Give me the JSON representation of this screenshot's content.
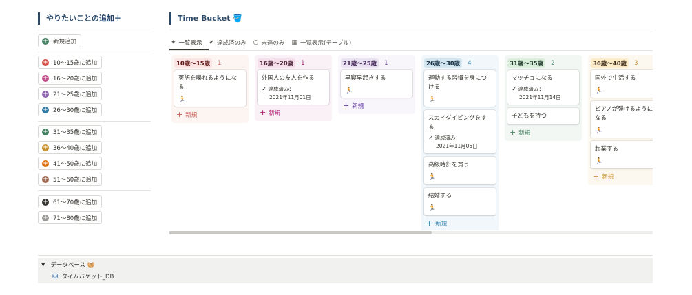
{
  "left": {
    "title": "やりたいことの追加＋",
    "new_button": "新規追加",
    "age_buttons": [
      {
        "label": "10〜15歳に追加",
        "color": "#d44c47"
      },
      {
        "label": "16〜20歳に追加",
        "color": "#c14c8a"
      },
      {
        "label": "21〜25歳に追加",
        "color": "#9065b0"
      },
      {
        "label": "26〜30歳に追加",
        "color": "#337ea9"
      },
      {
        "label": "31〜35歳に追加",
        "color": "#448361"
      },
      {
        "label": "36〜40歳に追加",
        "color": "#cb912f"
      },
      {
        "label": "41〜50歳に追加",
        "color": "#d9730d"
      },
      {
        "label": "51〜60歳に追加",
        "color": "#9f6b53"
      },
      {
        "label": "61〜70歳に追加",
        "color": "#37352f"
      },
      {
        "label": "71〜80歳に追加",
        "color": "#9b9a97"
      }
    ]
  },
  "main": {
    "title": "Time Bucket 🪣",
    "views": [
      {
        "label": "一覧表示",
        "icon": "sparkle-icon"
      },
      {
        "label": "達成済のみ",
        "icon": "check-circle-icon"
      },
      {
        "label": "未達のみ",
        "icon": "circle-icon"
      },
      {
        "label": "一覧表示(テーブル)",
        "icon": "table-icon"
      }
    ],
    "new_label": "新規",
    "done_label": "達成済み：",
    "runner": "🏃",
    "columns": [
      {
        "tag": "10歳〜15歳",
        "count": "1",
        "bg": "#fdf5f2",
        "tag_bg": "#fbe4e4",
        "tag_color": "#5d1715",
        "count_color": "#c4554d",
        "cards": [
          {
            "title": "英語を喋れるようになる",
            "runner": true
          }
        ]
      },
      {
        "tag": "16歳〜20歳",
        "count": "1",
        "bg": "#faf1f7",
        "tag_bg": "#f4dfeb",
        "tag_color": "#4c2337",
        "count_color": "#ad1a72",
        "cards": [
          {
            "title": "外国人の友人を作る",
            "done": "2021年11月01日"
          }
        ]
      },
      {
        "tag": "21歳〜25歳",
        "count": "1",
        "bg": "#f8f5fb",
        "tag_bg": "#eae4f2",
        "tag_color": "#412454",
        "count_color": "#6940a5",
        "cards": [
          {
            "title": "早寝早起きする",
            "runner": true
          }
        ]
      },
      {
        "tag": "26歳〜30歳",
        "count": "4",
        "bg": "#f1f7fb",
        "tag_bg": "#d3e5ef",
        "tag_color": "#183347",
        "count_color": "#337ea9",
        "cards": [
          {
            "title": "運動する習慣を身につける",
            "runner": true
          },
          {
            "title": "スカイダイビングをする",
            "done": "2021年11月05日"
          },
          {
            "title": "高級時計を買う",
            "runner": true
          },
          {
            "title": "結婚する",
            "runner": true
          }
        ]
      },
      {
        "tag": "31歳〜35歳",
        "count": "2",
        "bg": "#f2f7f4",
        "tag_bg": "#dbeddb",
        "tag_color": "#1c3829",
        "count_color": "#448361",
        "cards": [
          {
            "title": "マッチョになる",
            "done": "2021年11月14日"
          },
          {
            "title": "子どもを持つ"
          }
        ]
      },
      {
        "tag": "36歳〜40歳",
        "count": "3",
        "bg": "#fcf8ef",
        "tag_bg": "#fdecc8",
        "tag_color": "#402c1b",
        "count_color": "#cb912f",
        "cards": [
          {
            "title": "国外で生活する",
            "runner": true
          },
          {
            "title": "ピアノが弾けるようになる",
            "runner": true
          },
          {
            "title": "起業する",
            "runner": true
          }
        ]
      }
    ]
  },
  "bottom": {
    "toggle_label": "データベース 🧺",
    "db_label": "タイムバケット_DB"
  }
}
